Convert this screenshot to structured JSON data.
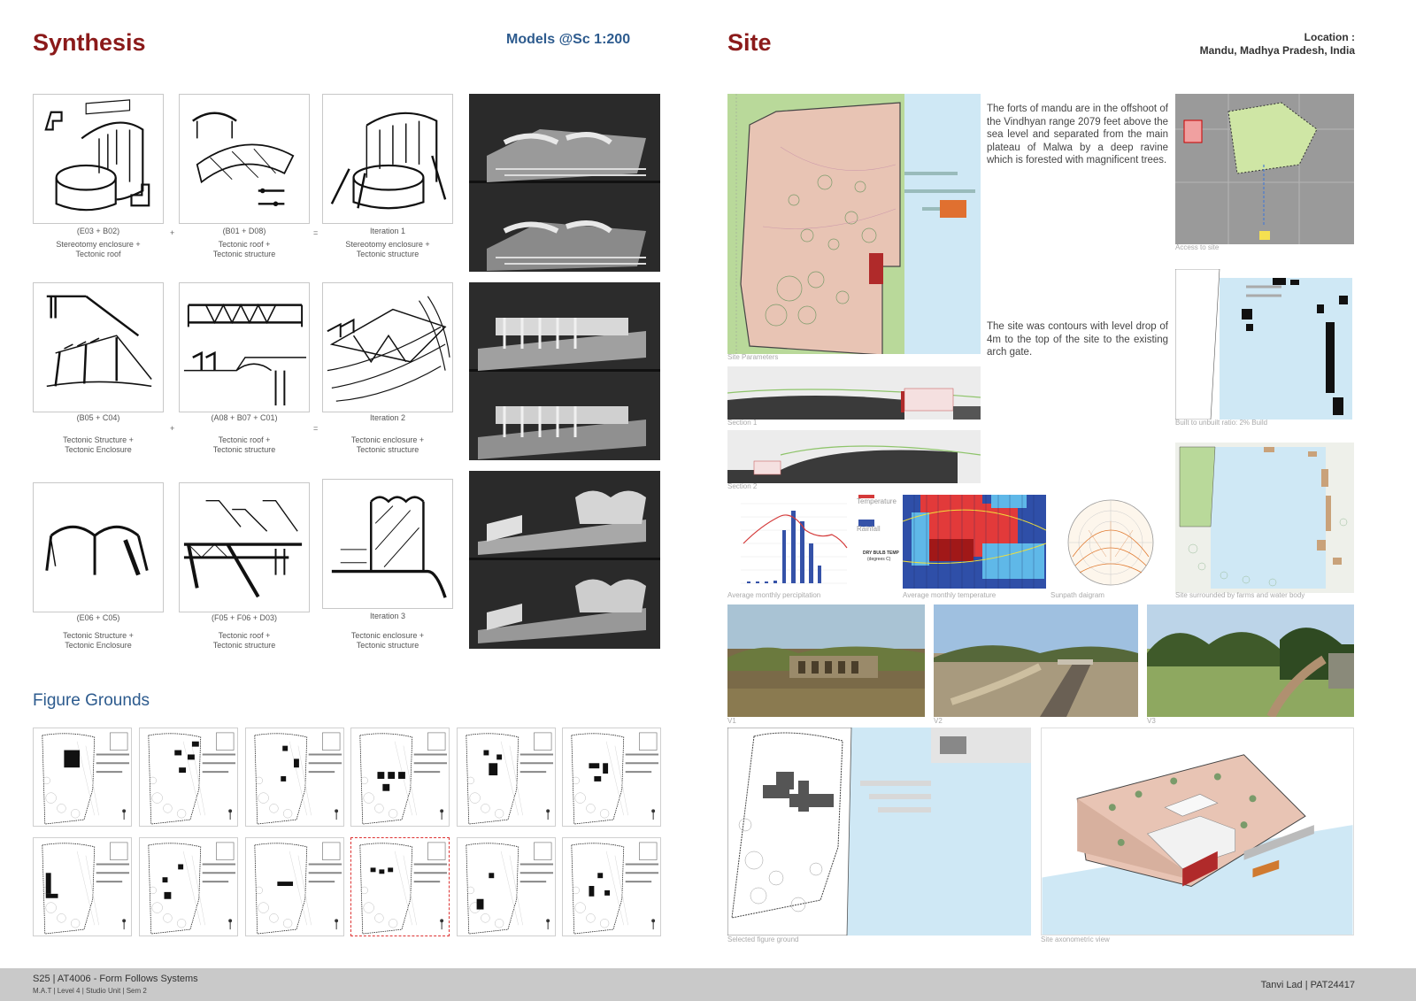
{
  "left": {
    "title": "Synthesis",
    "models_title": "Models @Sc 1:200",
    "rows": [
      {
        "items": [
          {
            "code": "(E03 + B02)",
            "desc1": "Stereotomy enclosure +",
            "desc2": "Tectonic roof"
          },
          {
            "code": "(B01 + D08)",
            "desc1": "Tectonic roof +",
            "desc2": "Tectonic structure"
          },
          {
            "code": "Iteration 1",
            "desc1": "Stereotomy enclosure +",
            "desc2": "Tectonic structure"
          }
        ]
      },
      {
        "items": [
          {
            "code": "(B05 + C04)",
            "desc1": "Tectonic Structure +",
            "desc2": "Tectonic Enclosure"
          },
          {
            "code": "(A08 + B07 + C01)",
            "desc1": "Tectonic roof +",
            "desc2": "Tectonic structure"
          },
          {
            "code": "Iteration 2",
            "desc1": "Tectonic enclosure +",
            "desc2": "Tectonic structure"
          }
        ]
      },
      {
        "items": [
          {
            "code": "(E06 + C05)",
            "desc1": "Tectonic Structure +",
            "desc2": "Tectonic Enclosure"
          },
          {
            "code": "(F05 + F06 + D03)",
            "desc1": "Tectonic roof +",
            "desc2": "Tectonic structure"
          },
          {
            "code": "Iteration 3",
            "desc1": "Tectonic enclosure +",
            "desc2": "Tectonic structure"
          }
        ]
      }
    ],
    "op_plus": "+",
    "op_equals": "=",
    "figure_grounds_title": "Figure Grounds"
  },
  "right": {
    "title": "Site",
    "location_label": "Location :",
    "location_value": "Mandu, Madhya Pradesh, India",
    "para1": "The forts of mandu are in the offshoot of the Vindhyan range  2079 feet above the sea level and separated from the main plateau of Malwa by a deep ravine which is forested with magnificent trees.",
    "para2": "The site was contours with level drop of 4m to the top of the site to the existing arch gate.",
    "labels": {
      "site_parameters": "Site Parameters",
      "section1": "Section 1",
      "section2": "Section 2",
      "access": "Access to site",
      "built_ratio": "Built to unbuilt ratio: 2% Build",
      "surrounded": "Site surrounded by farms and water body",
      "precip": "Average monthly percipitation",
      "temp": "Average monthly temperature",
      "sunpath": "Sunpath daigram",
      "v1": "V1",
      "v2": "V2",
      "v3": "V3",
      "selected_fg": "Selected figure ground",
      "axon": "Site axonometric view",
      "legend_temp": "Temperature",
      "legend_rain": "Rainfall",
      "dry_bulb": "DRY BULB TEMP",
      "dry_bulb_unit": "(degrees C)"
    }
  },
  "footer": {
    "course": "S25 | AT4006 - Form Follows Systems",
    "sub": "M.A.T | Level 4 | Studio Unit | Sem 2",
    "author": "Tanvi Lad | PAT24417"
  },
  "colors": {
    "heading_red": "#8b1a1a",
    "heading_blue": "#2d5b8e",
    "site_pink": "#e8c4b4",
    "water_blue": "#cfe8f5",
    "green": "#b9d99a"
  }
}
